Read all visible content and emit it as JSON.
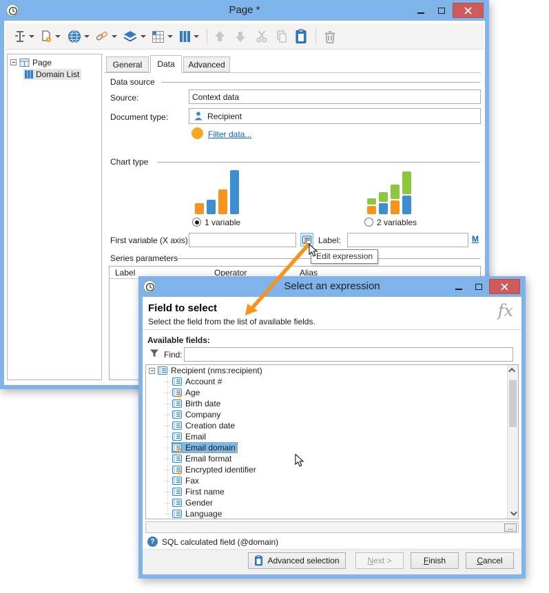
{
  "window1": {
    "title": "Page *",
    "tree": {
      "root_label": "Page",
      "child_label": "Domain List"
    },
    "tabs": {
      "general": "General",
      "data": "Data",
      "advanced": "Advanced"
    },
    "data_source": {
      "group": "Data source",
      "source_label": "Source:",
      "source_value": "Context data",
      "doc_type_label": "Document type:",
      "doc_type_value": "Recipient",
      "filter_link": "Filter data..."
    },
    "chart": {
      "group": "Chart type",
      "options": [
        {
          "label": "1 variable",
          "selected": true
        },
        {
          "label": "2 variables",
          "selected": false
        }
      ]
    },
    "xvar": {
      "label": "First variable (X axis):",
      "value": "",
      "label2": "Label:",
      "label2_value": "",
      "m_link": "M"
    },
    "series": {
      "group": "Series parameters",
      "col_label": "Label",
      "col_operator": "Operator",
      "col_alias": "Alias"
    }
  },
  "tooltip": {
    "text": "Edit expression"
  },
  "dialog": {
    "title": "Select an expression",
    "header_title": "Field to select",
    "header_subtitle": "Select the field from the list of available fields.",
    "fx_label": "fx",
    "available_fields_label": "Available fields:",
    "find_label": "Find:",
    "find_value": "",
    "root_field": "Recipient (nms:recipient)",
    "fields": [
      {
        "label": "Account #",
        "calculated": false,
        "selected": false
      },
      {
        "label": "Age",
        "calculated": true,
        "selected": false
      },
      {
        "label": "Birth date",
        "calculated": false,
        "selected": false
      },
      {
        "label": "Company",
        "calculated": false,
        "selected": false
      },
      {
        "label": "Creation date",
        "calculated": false,
        "selected": false
      },
      {
        "label": "Email",
        "calculated": false,
        "selected": false
      },
      {
        "label": "Email domain",
        "calculated": true,
        "selected": true
      },
      {
        "label": "Email format",
        "calculated": false,
        "selected": false
      },
      {
        "label": "Encrypted identifier",
        "calculated": true,
        "selected": false
      },
      {
        "label": "Fax",
        "calculated": false,
        "selected": false
      },
      {
        "label": "First name",
        "calculated": false,
        "selected": false
      },
      {
        "label": "Gender",
        "calculated": false,
        "selected": false
      },
      {
        "label": "Language",
        "calculated": false,
        "selected": false
      }
    ],
    "expression_value": "",
    "ellipsis_button": "...",
    "status_text": "SQL calculated field (@domain)",
    "buttons": {
      "advanced": "Advanced selection",
      "next": "Next >",
      "finish": "Finish",
      "cancel": "Cancel"
    }
  },
  "colors": {
    "titlebar_blue": "#7EB4EA",
    "close_red": "#CE5B5B",
    "accent_orange": "#F7941D",
    "link_blue": "#0563C1",
    "selection_blue": "#7DB9E8",
    "bar_blue": "#3D8FD1",
    "bar_orange": "#F7941D",
    "bar_green": "#8CC63F"
  }
}
